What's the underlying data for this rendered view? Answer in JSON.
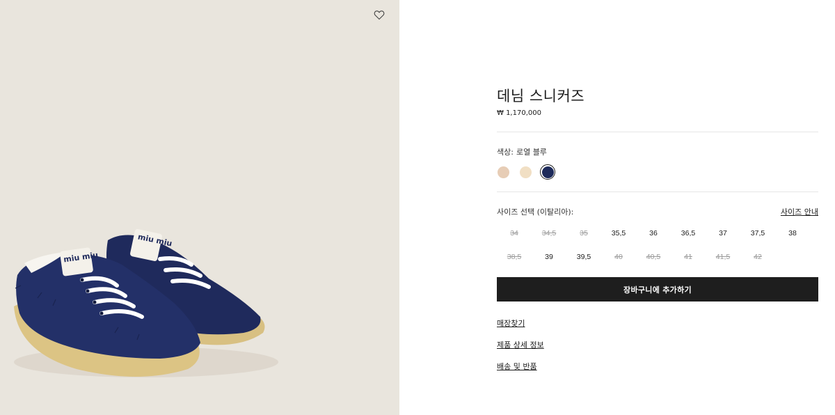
{
  "gallery": {
    "wishlist_icon": "heart-outline-icon",
    "image_subject": "navy denim low-top sneakers",
    "colors": {
      "background": "#e9e5dd",
      "shoe_body": "#1f2a5c",
      "shoe_sole": "#d9c28a",
      "laces": "#ffffff"
    },
    "logo_text": "miu miu"
  },
  "product": {
    "title": "데님 스니커즈",
    "price": "₩ 1,170,000"
  },
  "color": {
    "label": "색상:",
    "value": "로열 블루",
    "swatches": [
      {
        "name": "light-beige",
        "hex": "#e7cdb6",
        "selected": false
      },
      {
        "name": "cream",
        "hex": "#f1dfc4",
        "selected": false
      },
      {
        "name": "royal-blue",
        "hex": "#1d2a5a",
        "selected": true
      }
    ]
  },
  "size": {
    "label": "사이즈 선택 (이탈리아):",
    "guide_label": "사이즈 안내",
    "rows": [
      [
        {
          "label": "34",
          "available": false
        },
        {
          "label": "34,5",
          "available": false
        },
        {
          "label": "35",
          "available": false
        },
        {
          "label": "35,5",
          "available": true
        },
        {
          "label": "36",
          "available": true
        },
        {
          "label": "36,5",
          "available": true
        },
        {
          "label": "37",
          "available": true
        },
        {
          "label": "37,5",
          "available": true
        },
        {
          "label": "38",
          "available": true
        }
      ],
      [
        {
          "label": "38,5",
          "available": false
        },
        {
          "label": "39",
          "available": true
        },
        {
          "label": "39,5",
          "available": true
        },
        {
          "label": "40",
          "available": false
        },
        {
          "label": "40,5",
          "available": false
        },
        {
          "label": "41",
          "available": false
        },
        {
          "label": "41,5",
          "available": false
        },
        {
          "label": "42",
          "available": false
        }
      ]
    ]
  },
  "actions": {
    "add_to_cart": "장바구니에 추가하기"
  },
  "links": {
    "store_finder": "매장찾기",
    "product_details": "제품 상세 정보",
    "shipping_returns": "배송 및 반품"
  }
}
